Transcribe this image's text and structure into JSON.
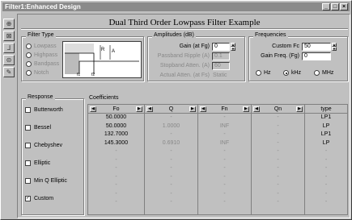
{
  "window": {
    "title": "Filter1:Enhanced Design"
  },
  "page": {
    "title": "Dual Third Order Lowpass Filter Example"
  },
  "filter_type": {
    "label": "Filter Type",
    "options": [
      "Lowpass",
      "Highpass",
      "Bandpass",
      "Notch"
    ],
    "graph_labels": {
      "f1": "f1",
      "f2": "f2",
      "r": "R",
      "a": "A"
    }
  },
  "amplitudes": {
    "label": "Amplitudes (dB)",
    "gain_label": "Gain (at Fg)",
    "gain_value": "0",
    "passband_label": "Passband Ripple (A)",
    "passband_value": "0.1",
    "stopband_label": "Stopband Atten. (A)",
    "stopband_value": "60",
    "actual_label": "Actual Atten. (at Fs)",
    "actual_value": "Static"
  },
  "frequencies": {
    "label": "Frequencies",
    "custom_label": "Custom Fc",
    "custom_value": "50",
    "gainfreq_label": "Gain Freq. (Fg)",
    "gainfreq_value": "0",
    "units": [
      "Hz",
      "kHz",
      "MHz"
    ],
    "selected_unit": "kHz"
  },
  "response": {
    "label": "Response",
    "items": [
      {
        "label": "Butterworth",
        "checked": false
      },
      {
        "label": "Bessel",
        "checked": false
      },
      {
        "label": "Chebyshev",
        "checked": false
      },
      {
        "label": "Elliptic",
        "checked": false
      },
      {
        "label": "Min Q Elliptic",
        "checked": false
      },
      {
        "label": "Custom",
        "checked": true
      }
    ]
  },
  "coefficients": {
    "label": "Coefficients",
    "headers": [
      "Fo",
      "Q",
      "Fn",
      "Qn",
      "type"
    ],
    "rows": [
      [
        "50.0000",
        "-",
        "-",
        "-",
        "LP1"
      ],
      [
        "50.0000",
        "1.0000",
        "INF",
        "-",
        "LP"
      ],
      [
        "132.7000",
        "-",
        "-",
        "-",
        "LP1"
      ],
      [
        "145.3000",
        "0.6910",
        "INF",
        "-",
        "LP"
      ],
      [
        "-",
        "-",
        "-",
        "-",
        "-"
      ],
      [
        "-",
        "-",
        "-",
        "-",
        "-"
      ],
      [
        "-",
        "-",
        "-",
        "-",
        "-"
      ],
      [
        "-",
        "-",
        "-",
        "-",
        "-"
      ],
      [
        "-",
        "-",
        "-",
        "-",
        "-"
      ],
      [
        "-",
        "-",
        "-",
        "-",
        "-"
      ],
      [
        "-",
        "-",
        "-",
        "-",
        "-"
      ]
    ]
  },
  "toolbar": {
    "icons": [
      "filter-icon",
      "chart-icon",
      "step-icon",
      "group-icon",
      "edit-icon"
    ]
  }
}
